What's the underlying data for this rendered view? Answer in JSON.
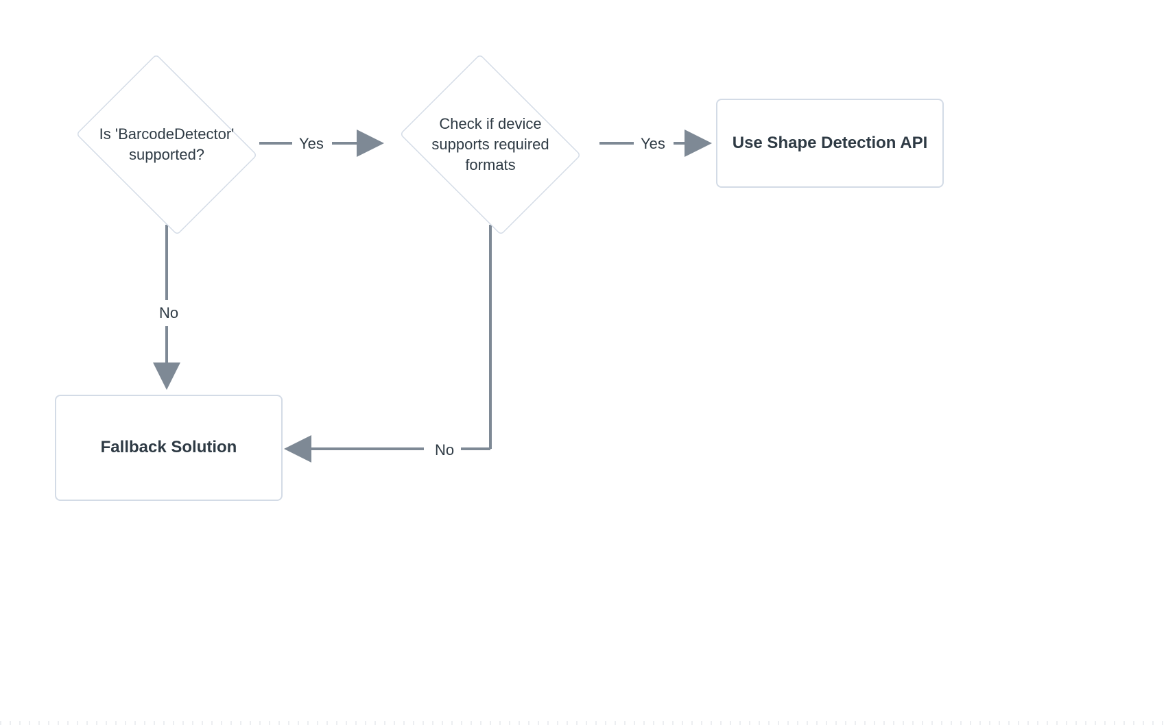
{
  "diagram": {
    "nodes": {
      "decision1": {
        "text": "Is 'BarcodeDetector' supported?"
      },
      "decision2": {
        "text": "Check if device supports required formats"
      },
      "result_api": {
        "text": "Use Shape Detection API"
      },
      "result_fallback": {
        "text": "Fallback Solution"
      }
    },
    "edges": {
      "d1_yes": "Yes",
      "d1_no": "No",
      "d2_yes": "Yes",
      "d2_no": "No"
    }
  }
}
